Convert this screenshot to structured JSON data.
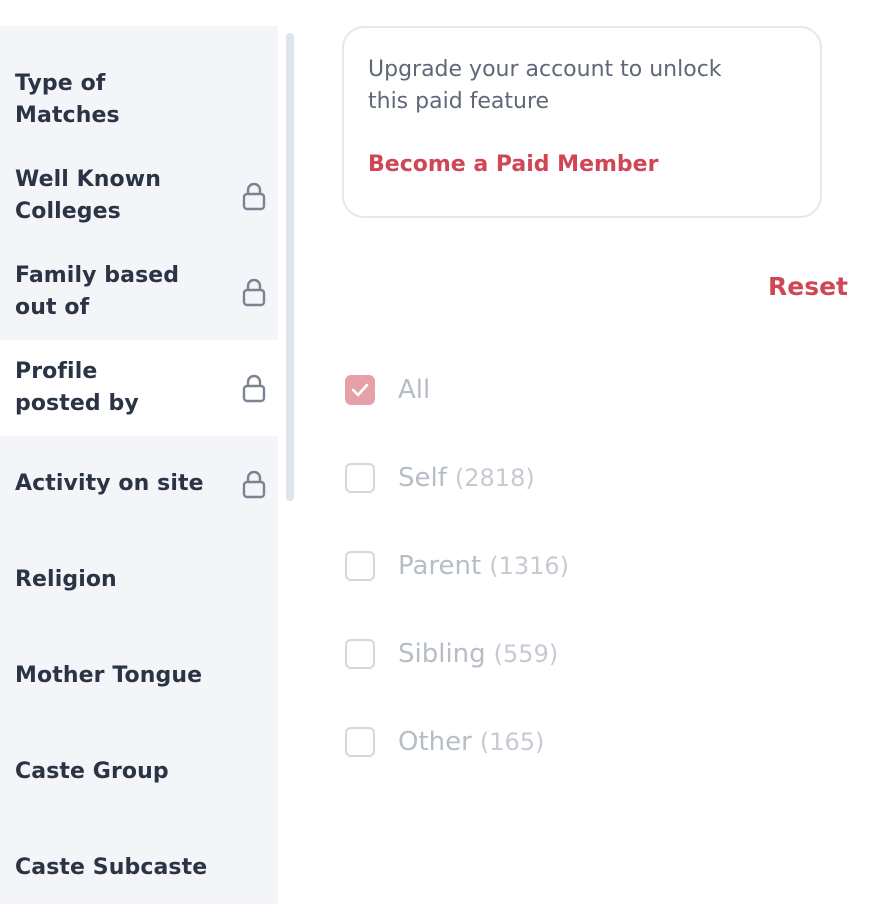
{
  "sidebar": {
    "items": [
      {
        "label": "Type of Matches",
        "locked": false,
        "active": false
      },
      {
        "label": "Well Known Colleges",
        "locked": true,
        "active": false
      },
      {
        "label": "Family based out of",
        "locked": true,
        "active": false
      },
      {
        "label": "Profile posted by",
        "locked": true,
        "active": true
      },
      {
        "label": "Activity on site",
        "locked": true,
        "active": false
      },
      {
        "label": "Religion",
        "locked": false,
        "active": false
      },
      {
        "label": "Mother Tongue",
        "locked": false,
        "active": false
      },
      {
        "label": "Caste Group",
        "locked": false,
        "active": false
      },
      {
        "label": "Caste Subcaste",
        "locked": false,
        "active": false
      }
    ]
  },
  "upgrade": {
    "message": "Upgrade your account to unlock this paid feature",
    "link_label": "Become a Paid Member"
  },
  "reset_label": "Reset",
  "options": [
    {
      "label": "All",
      "count": "",
      "checked": true
    },
    {
      "label": "Self",
      "count": "(2818)",
      "checked": false
    },
    {
      "label": "Parent",
      "count": "(1316)",
      "checked": false
    },
    {
      "label": "Sibling",
      "count": "(559)",
      "checked": false
    },
    {
      "label": "Other",
      "count": "(165)",
      "checked": false
    }
  ],
  "colors": {
    "accent": "#cf4756",
    "checked_box": "#e6a0a8",
    "sidebar_bg": "#f4f5f9",
    "sidebar_text": "#2b3445"
  },
  "icons": {
    "lock": "lock-icon",
    "check": "check-icon"
  }
}
